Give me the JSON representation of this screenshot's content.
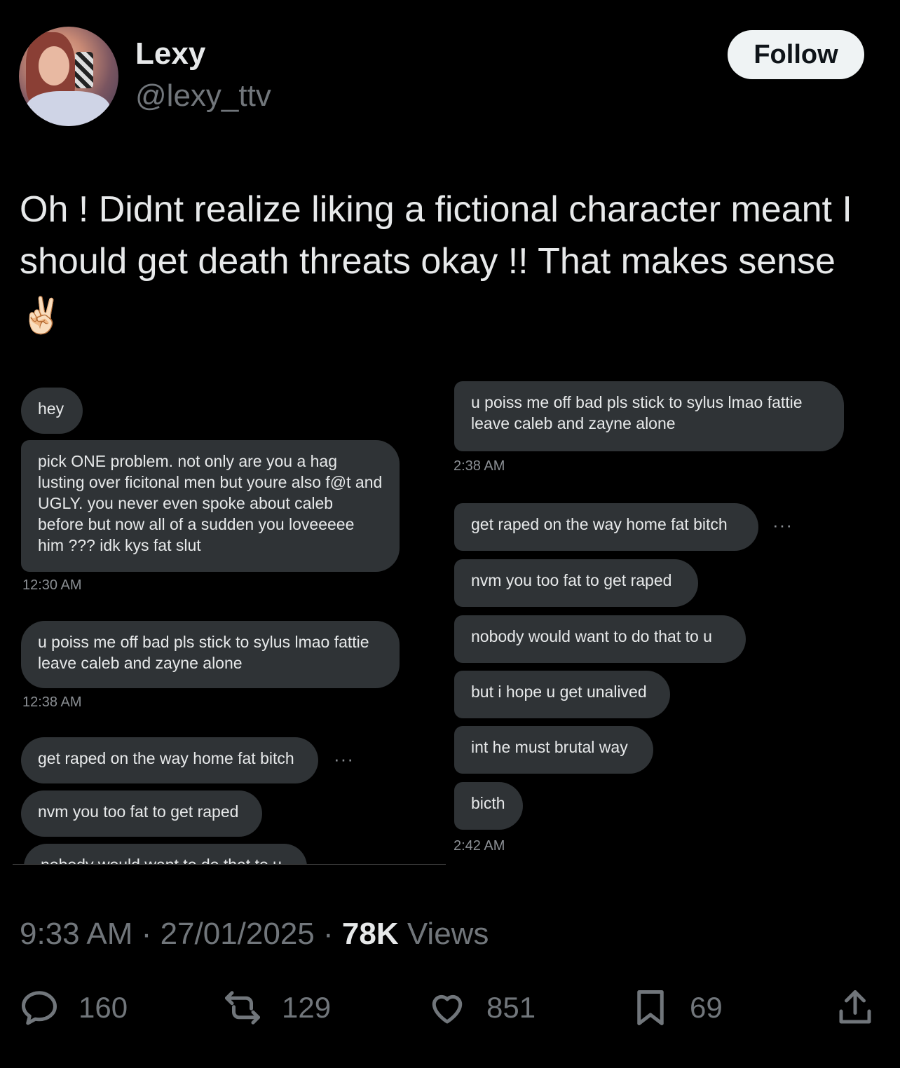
{
  "author": {
    "name": "Lexy",
    "handle": "@lexy_ttv",
    "follow_label": "Follow"
  },
  "tweet": {
    "text": "Oh ! Didnt realize liking a fictional character meant I should get death threats okay !! That makes sense",
    "emoji": "✌🏻"
  },
  "screenshot_left": {
    "messages": [
      "hey",
      "pick ONE problem. not only are you a hag lusting over ficitonal men but youre also f@t and UGLY.  you never even spoke about caleb before but now all of a sudden you loveeeee him ??? idk kys fat slut",
      "u poiss me off bad pls stick to sylus lmao fattie leave caleb and zayne alone",
      "get raped on the way home fat bitch",
      "nvm you too fat to get raped",
      "nobody would want to do that to u"
    ],
    "times": [
      "12:30 AM",
      "12:38 AM"
    ]
  },
  "screenshot_right": {
    "messages": [
      "u poiss me off bad pls stick to sylus lmao fattie leave caleb and zayne alone",
      "get raped on the way home fat bitch",
      "nvm you too fat to get raped",
      "nobody would want to do that to u",
      "but i hope u get unalived",
      "int he must brutal way",
      "bicth"
    ],
    "times": [
      "2:38 AM",
      "2:42 AM"
    ]
  },
  "meta": {
    "time": "9:33 AM",
    "date": "27/01/2025",
    "views_count": "78K",
    "views_label": "Views"
  },
  "actions": {
    "replies": "160",
    "reposts": "129",
    "likes": "851",
    "bookmarks": "69"
  }
}
